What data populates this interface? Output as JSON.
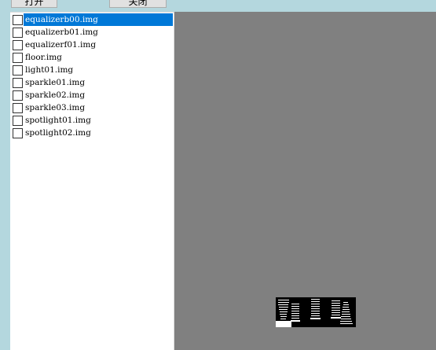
{
  "toolbar": {
    "open_label": "打开",
    "close_label": "关闭"
  },
  "file_list": {
    "items": [
      {
        "name": "equalizerb00.img",
        "checked": false,
        "selected": true
      },
      {
        "name": "equalizerb01.img",
        "checked": false,
        "selected": false
      },
      {
        "name": "equalizerf01.img",
        "checked": false,
        "selected": false
      },
      {
        "name": "floor.img",
        "checked": false,
        "selected": false
      },
      {
        "name": "light01.img",
        "checked": false,
        "selected": false
      },
      {
        "name": "sparkle01.img",
        "checked": false,
        "selected": false
      },
      {
        "name": "sparkle02.img",
        "checked": false,
        "selected": false
      },
      {
        "name": "sparkle03.img",
        "checked": false,
        "selected": false
      },
      {
        "name": "spotlight01.img",
        "checked": false,
        "selected": false
      },
      {
        "name": "spotlight02.img",
        "checked": false,
        "selected": false
      }
    ]
  },
  "preview": {
    "background": "#808080",
    "thumbnail": "equalizer-bars-image"
  },
  "colors": {
    "window_background": "#b4d7de",
    "selection": "#0078d7"
  }
}
